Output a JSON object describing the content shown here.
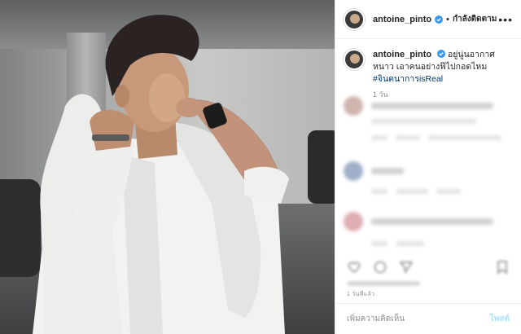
{
  "post": {
    "username": "antoine_pinto",
    "follow_status": "กำลังติดตาม",
    "separator": "•",
    "more_icon": "ellipsis-icon",
    "caption_text": "อยู่นู่นอากาศหนาว เอาคนอย่างฟีไปกอดไหม",
    "hashtag": "#จินตนาการisReal",
    "caption_time": "1 วัน",
    "posted_ago": "1 วันที่แล้ว",
    "comment_placeholder": "เพิ่มความคิดเห็น",
    "post_button": "โพสต์"
  },
  "colors": {
    "link": "#00376b",
    "verified": "#3897f0",
    "muted": "#8e8e8e",
    "post_button_disabled": "#b2dffc"
  },
  "icons": [
    "heart-icon",
    "comment-icon",
    "share-icon",
    "bookmark-icon",
    "verified-badge-icon"
  ]
}
